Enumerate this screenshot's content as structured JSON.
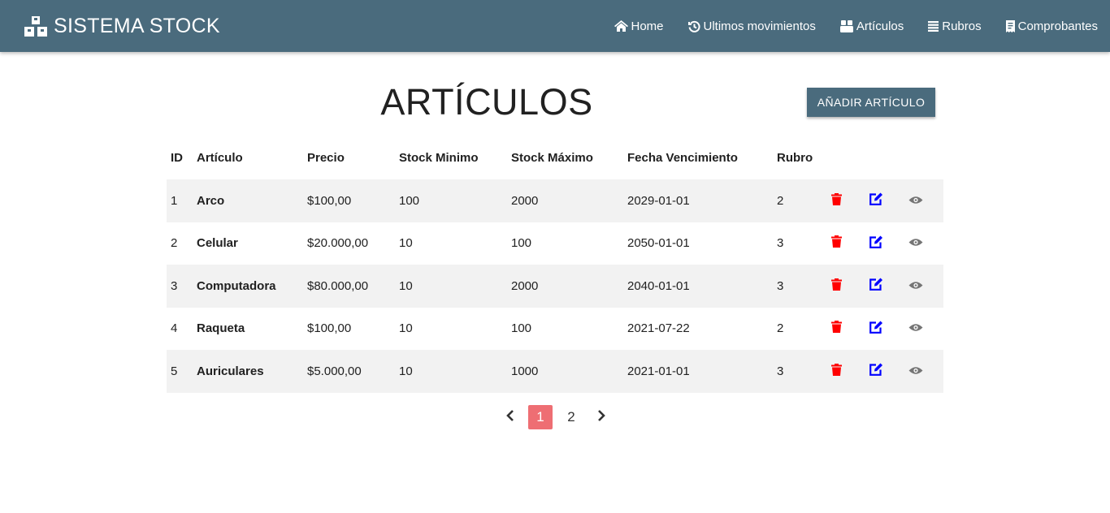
{
  "navbar": {
    "brand": "SISTEMA STOCK",
    "links": [
      {
        "label": "Home",
        "icon": "home-icon"
      },
      {
        "label": "Ultimos movimientos",
        "icon": "history-icon"
      },
      {
        "label": "Artículos",
        "icon": "cubes-icon"
      },
      {
        "label": "Rubros",
        "icon": "list-icon"
      },
      {
        "label": "Comprobantes",
        "icon": "receipt-icon"
      }
    ],
    "color": "#4a6b7d"
  },
  "page": {
    "title": "ARTÍCULOS",
    "add_button": "AÑADIR ARTÍCULO"
  },
  "table": {
    "headers": [
      "ID",
      "Artículo",
      "Precio",
      "Stock Minimo",
      "Stock Máximo",
      "Fecha Vencimiento",
      "Rubro"
    ],
    "rows": [
      {
        "id": "1",
        "name": "Arco",
        "price": "$100,00",
        "min": "100",
        "max": "2000",
        "expiry": "2029-01-01",
        "category": "2"
      },
      {
        "id": "2",
        "name": "Celular",
        "price": "$20.000,00",
        "min": "10",
        "max": "100",
        "expiry": "2050-01-01",
        "category": "3"
      },
      {
        "id": "3",
        "name": "Computadora",
        "price": "$80.000,00",
        "min": "10",
        "max": "2000",
        "expiry": "2040-01-01",
        "category": "3"
      },
      {
        "id": "4",
        "name": "Raqueta",
        "price": "$100,00",
        "min": "10",
        "max": "100",
        "expiry": "2021-07-22",
        "category": "2"
      },
      {
        "id": "5",
        "name": "Auriculares",
        "price": "$5.000,00",
        "min": "10",
        "max": "1000",
        "expiry": "2021-01-01",
        "category": "3"
      }
    ],
    "row_actions": [
      "trash-icon",
      "edit-icon",
      "eye-icon"
    ],
    "colors": {
      "delete": "#ff0000",
      "edit": "#0000ff",
      "view": "#757575"
    }
  },
  "pagination": {
    "pages": [
      "1",
      "2"
    ],
    "current": "1",
    "active_color": "#ee6e73"
  }
}
